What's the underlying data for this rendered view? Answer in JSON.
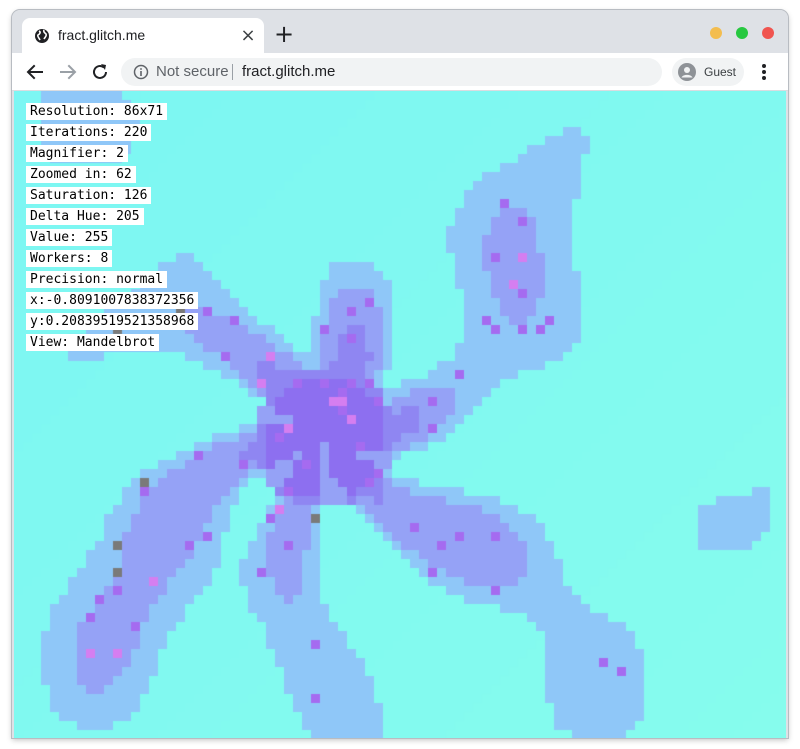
{
  "browser": {
    "tab_title": "fract.glitch.me",
    "tab_close": "×",
    "new_tab": "+",
    "security_label": "Not secure",
    "url": "fract.glitch.me",
    "profile_label": "Guest"
  },
  "icons": {
    "tab_favicon": "globe-icon",
    "back": "arrow-left-icon",
    "forward": "arrow-right-icon",
    "reload": "reload-icon",
    "info": "info-icon",
    "avatar": "user-icon",
    "menu": "kebab-menu-icon"
  },
  "colors": {
    "window_controls": [
      "#f3bd4f",
      "#27c840",
      "#f0544f"
    ],
    "fractal_background": "#7cf6f3",
    "fractal_interior": "#9aa6f7",
    "fractal_core": "#8a70f0"
  },
  "overlay": {
    "lines": [
      "Resolution: 86x71",
      "Iterations: 220",
      "Magnifier: 2",
      "Zoomed in: 62",
      "Saturation: 126",
      "Delta Hue: 205",
      "Value: 255",
      "Workers: 8",
      "Precision: normal",
      "x:-0.8091007838372356",
      "y:0.20839519521358968",
      "View: Mandelbrot"
    ]
  }
}
